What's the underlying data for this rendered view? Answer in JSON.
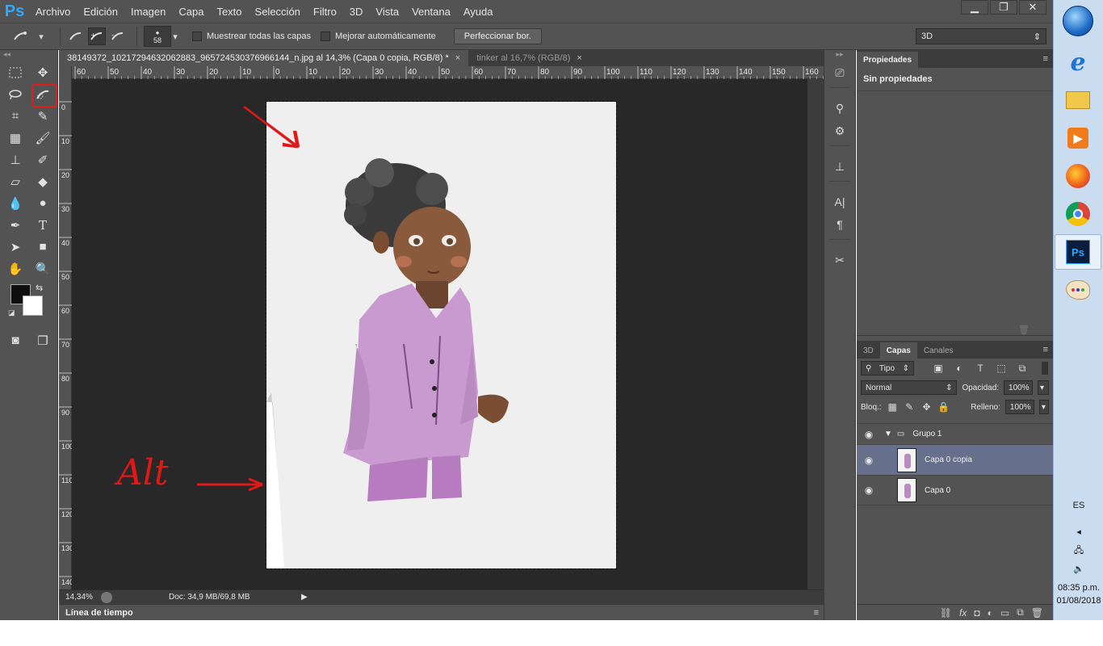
{
  "app": {
    "logo": "Ps"
  },
  "menu": [
    "Archivo",
    "Edición",
    "Imagen",
    "Capa",
    "Texto",
    "Selección",
    "Filtro",
    "3D",
    "Vista",
    "Ventana",
    "Ayuda"
  ],
  "window_controls": {
    "minimize": "▁",
    "restore": "❐",
    "close": "✕"
  },
  "options_bar": {
    "brush_size": "58",
    "sample_all_layers": "Muestrear todas las capas",
    "auto_enhance": "Mejorar automáticamente",
    "refine_edge": "Perfeccionar bor.",
    "workspace": "3D"
  },
  "tabs": [
    {
      "label": "38149372_10217294632062883_965724530376966144_n.jpg al 14,3% (Capa 0 copia, RGB/8) *",
      "close": "×"
    },
    {
      "label": "tinker al 16,7% (RGB/8)",
      "close": "×"
    }
  ],
  "ruler": {
    "h_ticks": [
      "60",
      "50",
      "40",
      "30",
      "20",
      "10",
      "0",
      "10",
      "20",
      "30",
      "40",
      "50",
      "60",
      "70",
      "80",
      "90",
      "100",
      "110",
      "120",
      "130",
      "140",
      "150",
      "160"
    ],
    "v_ticks": [
      "0",
      "10",
      "20",
      "30",
      "40",
      "50",
      "60",
      "70",
      "80",
      "90",
      "100",
      "110",
      "120",
      "130",
      "140"
    ]
  },
  "annotation": {
    "text": "Alt"
  },
  "status": {
    "zoom": "14,34%",
    "doc": "Doc: 34,9 MB/69,8 MB"
  },
  "timeline": {
    "label": "Línea de tiempo"
  },
  "properties": {
    "tab": "Propiedades",
    "empty": "Sin propiedades"
  },
  "layers_panel": {
    "tabs": [
      "3D",
      "Capas",
      "Canales"
    ],
    "kind_filter": "Tipo",
    "blend_mode": "Normal",
    "opacity_label": "Opacidad:",
    "opacity": "100%",
    "lock_label": "Bloq.:",
    "fill_label": "Relleno:",
    "fill": "100%",
    "layers": [
      {
        "name": "Grupo 1",
        "type": "group"
      },
      {
        "name": "Capa 0 copia",
        "type": "layer",
        "selected": true
      },
      {
        "name": "Capa 0",
        "type": "layer",
        "selected": false
      }
    ]
  },
  "taskbar": {
    "lang": "ES",
    "time": "08:35 p.m.",
    "date": "01/08/2018",
    "ps_icon": "Ps"
  }
}
